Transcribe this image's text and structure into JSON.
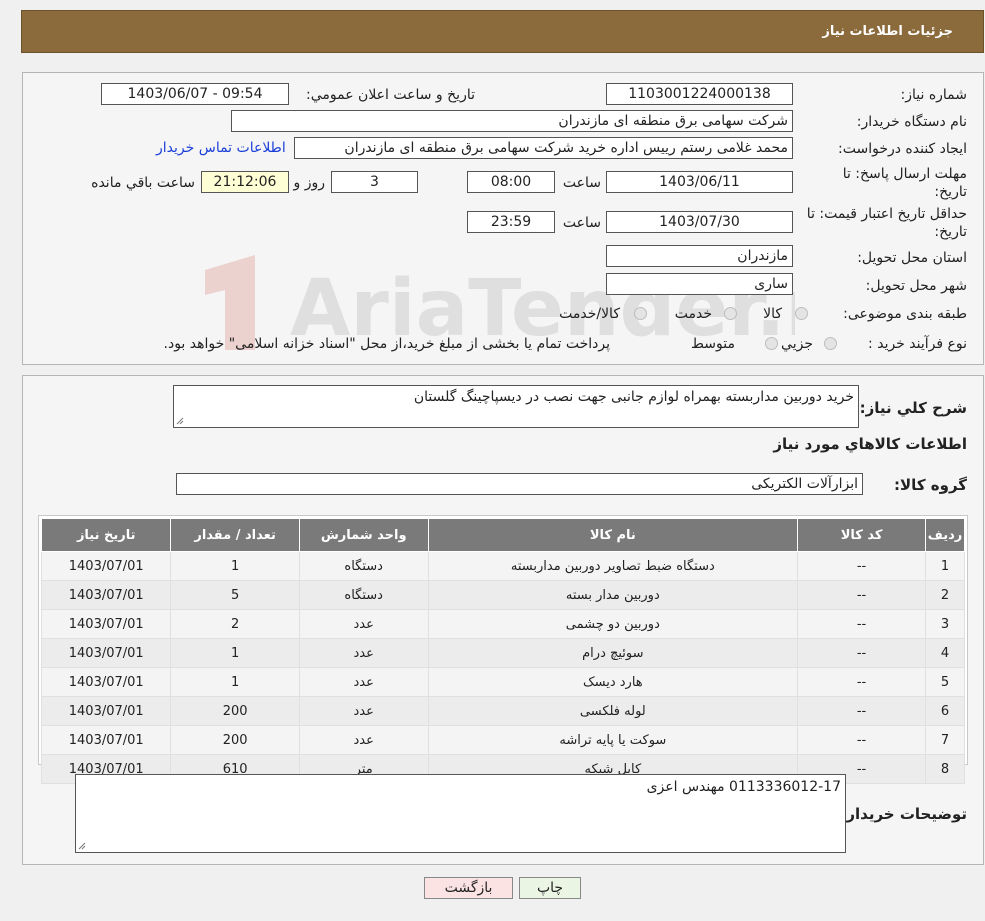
{
  "header": {
    "title": "جزئیات اطلاعات نیاز"
  },
  "fields": {
    "need_number_label": "شماره نیاز:",
    "need_number": "1103001224000138",
    "announce_label": "تاریخ و ساعت اعلان عمومي:",
    "announce_value": "1403/06/07 - 09:54",
    "buyer_org_label": "نام دستگاه خريدار:",
    "buyer_org": "شرکت سهامی برق منطقه ای مازندران",
    "requester_label": "ايجاد کننده درخواست:",
    "requester": "محمد غلامی رستم رییس اداره خرید شرکت سهامی برق منطقه ای مازندران",
    "contact_link": "اطلاعات تماس خریدار",
    "deadline_label_1": "مهلت ارسال پاسخ: تا",
    "deadline_label_2": "تاریخ:",
    "deadline_date": "1403/06/11",
    "time_label": "ساعت",
    "deadline_time": "08:00",
    "days_value": "3",
    "days_label": "روز و",
    "remaining_time": "21:12:06",
    "remaining_label": "ساعت باقي مانده",
    "validity_label_1": "حداقل تاریخ اعتبار قیمت: تا",
    "validity_label_2": "تاریخ:",
    "validity_date": "1403/07/30",
    "validity_time": "23:59",
    "province_label": "استان محل تحويل:",
    "province": "مازندران",
    "city_label": "شهر محل تحويل:",
    "city": "ساری",
    "category_label": "طبقه بندی موضوعی:",
    "category_options": [
      "کالا",
      "خدمت",
      "کالا/خدمت"
    ],
    "process_label": "نوع فرآيند خريد :",
    "process_options": [
      "جزيي",
      "متوسط"
    ],
    "process_note": "پرداخت تمام یا بخشی از مبلغ خرید،از محل \"اسناد خزانه اسلامی\" خواهد بود."
  },
  "description": {
    "label": "شرح کلي نياز:",
    "text": "خرید دوربین مداربسته بهمراه لوازم جانبی جهت نصب در دیسپاچینگ گلستان"
  },
  "items_section": {
    "title": "اطلاعات کالاهاي مورد نياز",
    "group_label": "گروه کالا:",
    "group_value": "ابزارآلات الکتريکی"
  },
  "table": {
    "headers": [
      "رديف",
      "کد کالا",
      "نام کالا",
      "واحد شمارش",
      "تعداد / مقدار",
      "تاريخ نياز"
    ],
    "rows": [
      [
        "1",
        "--",
        "دستگاه ضبط تصاویر دوربین مداربسته",
        "دستگاه",
        "1",
        "1403/07/01"
      ],
      [
        "2",
        "--",
        "دوربین مدار بسته",
        "دستگاه",
        "5",
        "1403/07/01"
      ],
      [
        "3",
        "--",
        "دوربین دو چشمی",
        "عدد",
        "2",
        "1403/07/01"
      ],
      [
        "4",
        "--",
        "سوئیچ درام",
        "عدد",
        "1",
        "1403/07/01"
      ],
      [
        "5",
        "--",
        "هارد دیسک",
        "عدد",
        "1",
        "1403/07/01"
      ],
      [
        "6",
        "--",
        "لوله فلکسی",
        "عدد",
        "200",
        "1403/07/01"
      ],
      [
        "7",
        "--",
        "سوکت یا پایه تراشه",
        "عدد",
        "200",
        "1403/07/01"
      ],
      [
        "8",
        "--",
        "کابل شبکه",
        "متر",
        "610",
        "1403/07/01"
      ]
    ]
  },
  "buyer_notes": {
    "label": "توضيحات خريدار:",
    "text": "0113336012-17 مهندس اعزی"
  },
  "buttons": {
    "print": "چاپ",
    "back": "بازگشت"
  },
  "watermark": "AriaTender.neT",
  "colors": {
    "header_bg": "#8b6a3b",
    "table_header_bg": "#7a7a7a",
    "link": "#1a3ed8"
  }
}
